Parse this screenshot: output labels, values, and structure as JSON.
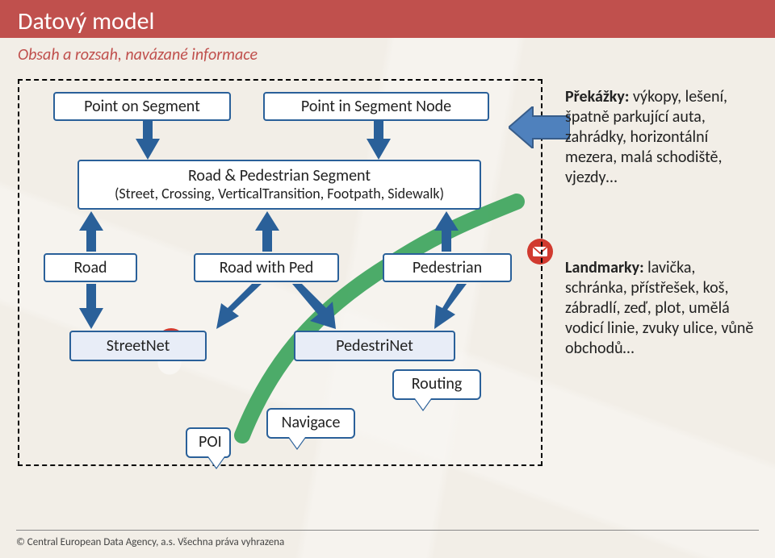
{
  "header": {
    "title": "Datový model"
  },
  "subtitle": "Obsah a rozsah, navázané informace",
  "boxes": {
    "point_on_segment": "Point on Segment",
    "point_in_segment_node": "Point in Segment Node",
    "road_ped_segment_line1": "Road & Pedestrian Segment",
    "road_ped_segment_line2": "(Street, Crossing, VerticalTransition, Footpath, Sidewalk)",
    "road": "Road",
    "road_with_ped": "Road with Ped",
    "pedestrian": "Pedestrian",
    "streetnet": "StreetNet",
    "pedestrinet": "PedestriNet"
  },
  "callouts": {
    "poi": "POI",
    "navigace": "Navigace",
    "routing": "Routing"
  },
  "side": {
    "obstacles_title": "Překážky:",
    "obstacles_body": " výkopy, lešení, špatně parkující auta, zahrádky, horizontální mezera, malá schodiště, vjezdy…",
    "landmarks_title": "Landmarky:",
    "landmarks_body": " lavička, schránka, přístřešek, koš, zábradlí, zeď, plot, umělá vodicí linie, zvuky ulice, vůně obchodů…"
  },
  "footer": "© Central European Data Agency, a.s. Všechna práva vyhrazena"
}
